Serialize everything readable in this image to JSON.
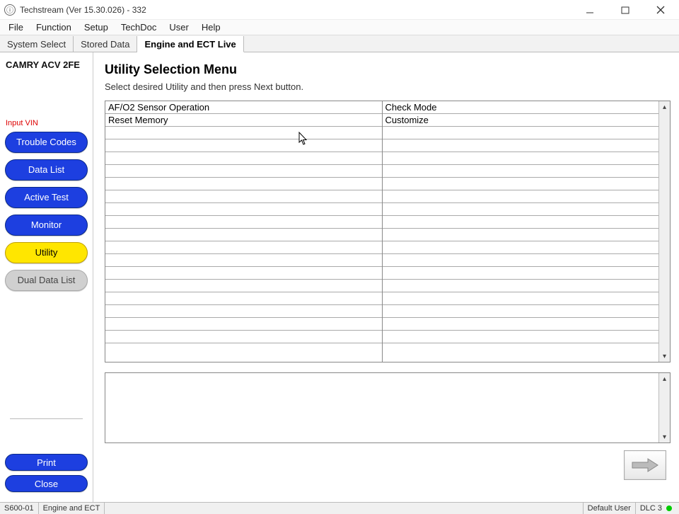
{
  "window": {
    "title": "Techstream (Ver 15.30.026) - 332"
  },
  "menubar": [
    "File",
    "Function",
    "Setup",
    "TechDoc",
    "User",
    "Help"
  ],
  "tabs": [
    {
      "label": "System Select",
      "active": false
    },
    {
      "label": "Stored Data",
      "active": false
    },
    {
      "label": "Engine and ECT Live",
      "active": true
    }
  ],
  "sidebar": {
    "vehicle": "CAMRY ACV 2FE",
    "input_vin": "Input VIN",
    "buttons": [
      {
        "label": "Trouble Codes",
        "style": "blue"
      },
      {
        "label": "Data List",
        "style": "blue"
      },
      {
        "label": "Active Test",
        "style": "blue"
      },
      {
        "label": "Monitor",
        "style": "blue"
      },
      {
        "label": "Utility",
        "style": "yellow"
      },
      {
        "label": "Dual Data List",
        "style": "grey"
      }
    ],
    "bottom": [
      {
        "label": "Print"
      },
      {
        "label": "Close"
      }
    ]
  },
  "main": {
    "heading": "Utility Selection Menu",
    "instruction": "Select desired Utility and then press Next button.",
    "grid": {
      "col1": [
        "AF/O2 Sensor Operation",
        "Reset Memory"
      ],
      "col2": [
        "Check Mode",
        "Customize"
      ]
    }
  },
  "statusbar": {
    "code": "S600-01",
    "system": "Engine and ECT",
    "user": "Default User",
    "dlc": "DLC 3"
  }
}
